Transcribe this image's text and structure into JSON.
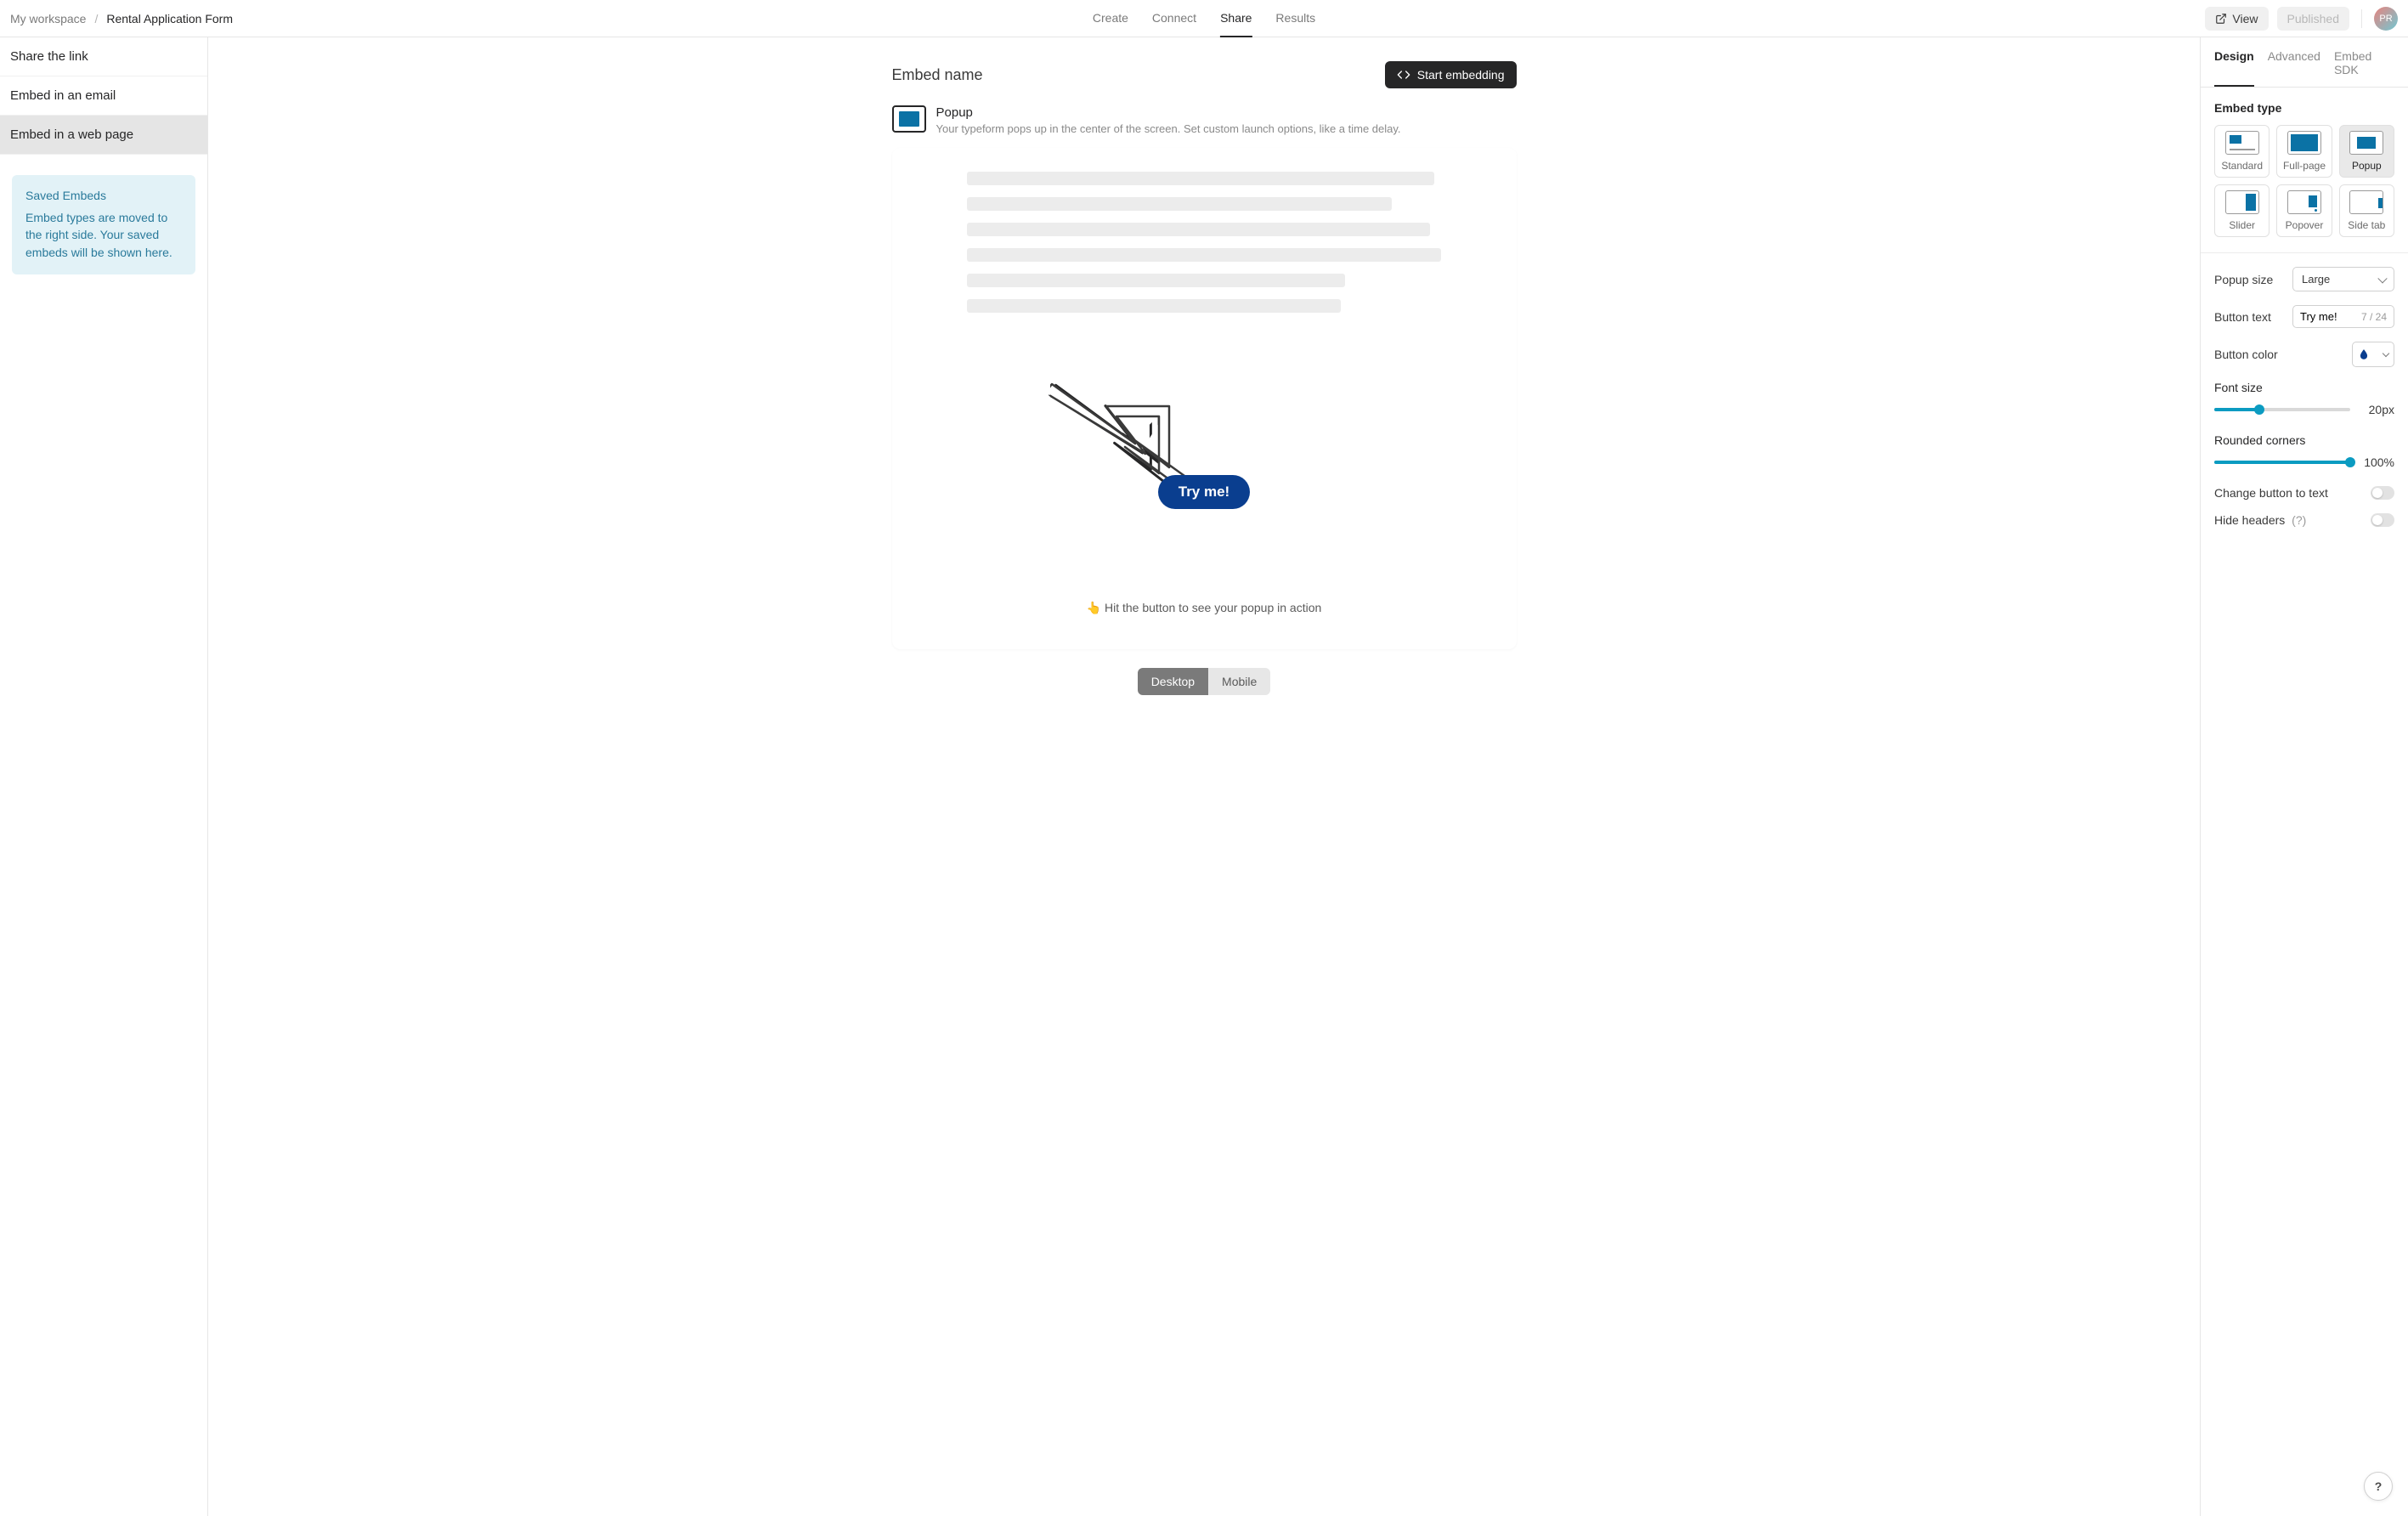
{
  "breadcrumb": {
    "workspace": "My workspace",
    "sep": "/",
    "title": "Rental Application Form"
  },
  "nav": {
    "create": "Create",
    "connect": "Connect",
    "share": "Share",
    "results": "Results"
  },
  "tools": {
    "view": "View",
    "published": "Published"
  },
  "avatar": {
    "initials": "PR"
  },
  "leftnav": {
    "link": "Share the link",
    "email": "Embed in an email",
    "web": "Embed in a web page"
  },
  "savedBox": {
    "head": "Saved Embeds",
    "body": "Embed types are moved to the right side. Your saved embeds will be shown here."
  },
  "center": {
    "headName": "Embed name",
    "startEmbedding": "Start embedding",
    "popupTitle": "Popup",
    "popupDesc": "Your typeform pops up in the center of the screen. Set custom launch options, like a time delay.",
    "tryBtn": "Try me!",
    "hint": "👆 Hit the button to see your popup in action",
    "desktop": "Desktop",
    "mobile": "Mobile"
  },
  "right": {
    "tabs": {
      "design": "Design",
      "advanced": "Advanced",
      "sdk": "Embed SDK"
    },
    "embedTypeHead": "Embed type",
    "types": {
      "standard": "Standard",
      "full": "Full-page",
      "popup": "Popup",
      "slider": "Slider",
      "popover": "Popover",
      "sidetab": "Side tab"
    },
    "popupSize": {
      "label": "Popup size",
      "value": "Large"
    },
    "buttonText": {
      "label": "Button text",
      "value": "Try me!",
      "count": "7 / 24"
    },
    "buttonColor": {
      "label": "Button color",
      "value": "#0a3e8f"
    },
    "fontSize": {
      "label": "Font size",
      "valueText": "20px",
      "pct": 33
    },
    "rounded": {
      "label": "Rounded corners",
      "valueText": "100%",
      "pct": 100
    },
    "changeToText": {
      "label": "Change button to text"
    },
    "hideHeaders": {
      "label": "Hide headers",
      "hint": "(?)"
    }
  },
  "help": "?"
}
